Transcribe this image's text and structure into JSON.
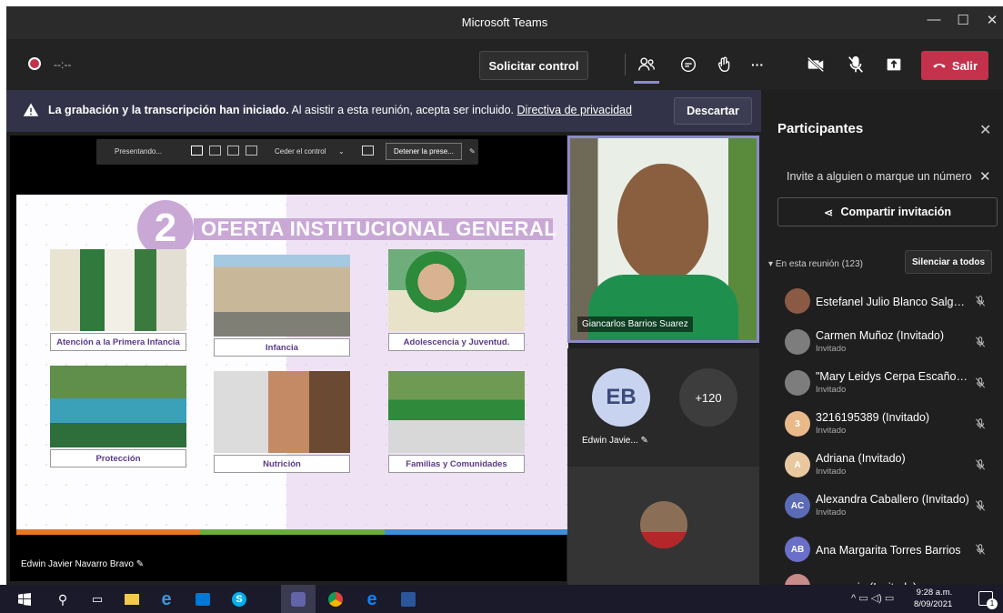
{
  "window": {
    "title": "Microsoft Teams"
  },
  "toolbar": {
    "timer": "--:--",
    "request_control": "Solicitar control",
    "leave": "Salir",
    "more": "···"
  },
  "banner": {
    "bold": "La grabación y la transcripción han iniciado.",
    "text": "Al asistir a esta reunión, acepta ser incluido.",
    "link": "Directiva de privacidad",
    "dismiss": "Descartar"
  },
  "presenter_bar": {
    "presenting": "Presentando...",
    "give_control": "Ceder el control",
    "stop": "Detener la prese..."
  },
  "slide": {
    "number": "2",
    "title": "OFERTA INSTITUCIONAL GENERAL",
    "cards": [
      "Atención a la Primera Infancia",
      "Infancia",
      "Adolescencia y Juventud.",
      "Protección",
      "Nutrición",
      "Familias y Comunidades"
    ]
  },
  "share_name": "Edwin Javier Navarro Bravo",
  "video": {
    "name": "Giancarlos Barrios Suarez"
  },
  "tiles": {
    "initials": "EB",
    "more": "+120",
    "name": "Edwin Javie..."
  },
  "panel": {
    "title": "Participantes",
    "invite_placeholder": "Invite a alguien o marque un número",
    "share_invite": "Compartir invitación",
    "section": "En esta reunión (123)",
    "mute_all": "Silenciar a todos",
    "participants": [
      {
        "name": "Estefanel Julio Blanco Salgado",
        "sub": "",
        "initials": "",
        "color": "#8a5a44"
      },
      {
        "name": "Carmen Muñoz (Invitado)",
        "sub": "Invitado",
        "initials": "",
        "color": "#7d7d7d"
      },
      {
        "name": "\"Mary Leidys Cerpa Escaño (I...",
        "sub": "Invitado",
        "initials": "",
        "color": "#7d7d7d"
      },
      {
        "name": "3216195389 (Invitado)",
        "sub": "Invitado",
        "initials": "3",
        "color": "#e9b98a"
      },
      {
        "name": "Adriana (Invitado)",
        "sub": "Invitado",
        "initials": "A",
        "color": "#e9c8a0"
      },
      {
        "name": "Alexandra Caballero (Invitado)",
        "sub": "Invitado",
        "initials": "AC",
        "color": "#5b6bb5"
      },
      {
        "name": "Ana Margarita Torres Barrios",
        "sub": "",
        "initials": "AB",
        "color": "#6a6fc9"
      },
      {
        "name": "ana maria (Invitado)",
        "sub": "",
        "initials": "",
        "color": "#c98a8a"
      }
    ]
  },
  "taskbar": {
    "time": "9:28 a.m.",
    "date": "8/09/2021",
    "notif": "1"
  },
  "colors": {
    "leave": "#c4314b",
    "accent": "#6264a7",
    "banner": "#323348"
  }
}
